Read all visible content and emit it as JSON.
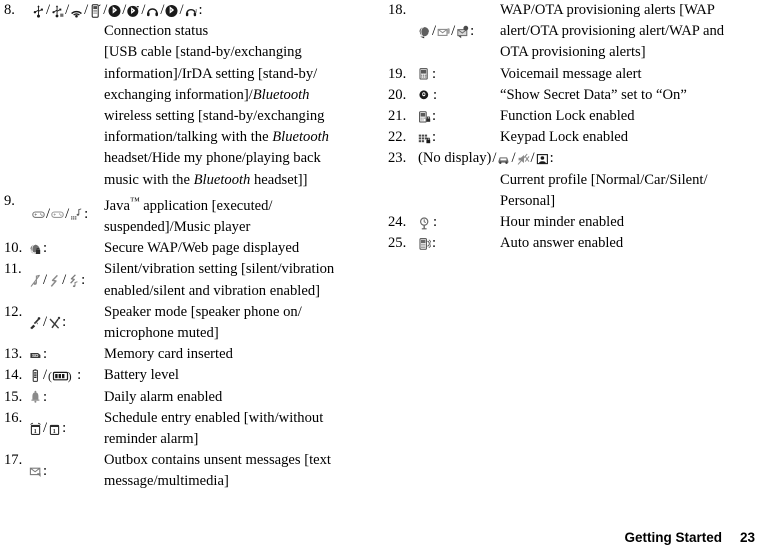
{
  "document": {
    "footer": {
      "section": "Getting Started",
      "page_number": "23"
    }
  },
  "left_column": {
    "entries": [
      {
        "number": "8.",
        "icons": [
          "usb-standby-icon",
          "usb-exchanging-icon",
          "irda-icon",
          "irda-exchanging-icon",
          "bluetooth-standby-icon",
          "bluetooth-exchanging-icon",
          "bluetooth-headset-icon",
          "bluetooth-hide-icon",
          "bluetooth-music-icon"
        ],
        "icon_count": 9,
        "wide": true,
        "lines": [
          "Connection status",
          "[USB cable [stand-by/exchanging",
          "information]/IrDA setting [stand-by/",
          "exchanging information]/BLUETOOTH_ITALIC",
          "wireless setting [stand-by/exchanging",
          "information/talking with the BLUETOOTH_ITALIC",
          "headset/Hide my phone/playing back",
          "music with the BLUETOOTH_ITALIC headset]]"
        ],
        "description": "Connection status [USB cable [stand-by/exchanging information]/IrDA setting [stand-by/exchanging information]/Bluetooth wireless setting [stand-by/exchanging information/talking with the Bluetooth headset/Hide my phone/playing back music with the Bluetooth headset]]"
      },
      {
        "number": "9.",
        "icons": [
          "java-executed-icon",
          "java-suspended-icon",
          "music-player-icon"
        ],
        "icon_count": 3,
        "wide": false,
        "lines": [
          "Java™ application [executed/",
          "suspended]/Music player"
        ],
        "description": "Java™ application [executed/suspended]/Music player"
      },
      {
        "number": "10.",
        "icons": [
          "secure-wap-icon"
        ],
        "icon_count": 1,
        "wide": false,
        "lines": [
          "Secure WAP/Web page displayed"
        ],
        "description": "Secure WAP/Web page displayed"
      },
      {
        "number": "11.",
        "icons": [
          "silent-icon",
          "vibration-icon",
          "silent-vibration-icon"
        ],
        "icon_count": 3,
        "wide": false,
        "lines": [
          "Silent/vibration setting [silent/vibration",
          "enabled/silent and vibration enabled]"
        ],
        "description": "Silent/vibration setting [silent/vibration enabled/silent and vibration enabled]"
      },
      {
        "number": "12.",
        "icons": [
          "speaker-phone-icon",
          "microphone-muted-icon"
        ],
        "icon_count": 2,
        "wide": false,
        "lines": [
          "Speaker mode [speaker phone on/",
          "microphone muted]"
        ],
        "description": "Speaker mode [speaker phone on/microphone muted]"
      },
      {
        "number": "13.",
        "icons": [
          "memory-card-icon"
        ],
        "icon_count": 1,
        "wide": false,
        "lines": [
          "Memory card inserted"
        ],
        "description": "Memory card inserted"
      },
      {
        "number": "14.",
        "icons": [
          "battery-level-icon",
          "battery-charging-icon"
        ],
        "icon_count": 2,
        "wide": false,
        "lines": [
          "Battery level"
        ],
        "description": "Battery level"
      },
      {
        "number": "15.",
        "icons": [
          "daily-alarm-icon"
        ],
        "icon_count": 1,
        "wide": false,
        "lines": [
          "Daily alarm enabled"
        ],
        "description": "Daily alarm enabled"
      },
      {
        "number": "16.",
        "icons": [
          "schedule-with-alarm-icon",
          "schedule-without-alarm-icon"
        ],
        "icon_count": 2,
        "wide": false,
        "lines": [
          "Schedule entry enabled [with/without",
          "reminder alarm]"
        ],
        "description": "Schedule entry enabled [with/without reminder alarm]"
      },
      {
        "number": "17.",
        "icons": [
          "outbox-unsent-icon"
        ],
        "icon_count": 1,
        "wide": false,
        "lines": [
          "Outbox contains unsent messages [text",
          "message/multimedia]"
        ],
        "description": "Outbox contains unsent messages [text message/multimedia]"
      }
    ]
  },
  "right_column": {
    "entries": [
      {
        "number": "18.",
        "icons": [
          "wap-alert-icon",
          "ota-provisioning-alert-icon",
          "wap-ota-alerts-icon"
        ],
        "icon_count": 3,
        "wide": false,
        "lines": [
          "WAP/OTA provisioning alerts [WAP",
          "alert/OTA provisioning alert/WAP and",
          "OTA provisioning alerts]"
        ],
        "description": "WAP/OTA provisioning alerts [WAP alert/OTA provisioning alert/WAP and OTA provisioning alerts]"
      },
      {
        "number": "19.",
        "icons": [
          "voicemail-alert-icon"
        ],
        "icon_count": 1,
        "wide": false,
        "lines": [
          "Voicemail message alert"
        ],
        "description": "Voicemail message alert"
      },
      {
        "number": "20.",
        "icons": [
          "show-secret-data-icon"
        ],
        "icon_count": 1,
        "wide": false,
        "lines": [
          "“Show Secret Data” set to “On”"
        ],
        "description": "“Show Secret Data” set to “On”"
      },
      {
        "number": "21.",
        "icons": [
          "function-lock-icon"
        ],
        "icon_count": 1,
        "wide": false,
        "lines": [
          "Function Lock enabled"
        ],
        "description": "Function Lock enabled"
      },
      {
        "number": "22.",
        "icons": [
          "keypad-lock-icon"
        ],
        "icon_count": 1,
        "wide": false,
        "lines": [
          "Keypad Lock enabled"
        ],
        "description": "Keypad Lock enabled"
      },
      {
        "number": "23.",
        "no_display_label": "(No display)",
        "icons": [
          "car-profile-icon",
          "silent-profile-icon",
          "personal-profile-icon"
        ],
        "icon_count": 3,
        "wide": true,
        "lines": [
          "Current profile [Normal/Car/Silent/",
          "Personal]"
        ],
        "description": "Current profile [Normal/Car/Silent/Personal]"
      },
      {
        "number": "24.",
        "icons": [
          "hour-minder-icon"
        ],
        "icon_count": 1,
        "wide": false,
        "lines": [
          "Hour minder enabled"
        ],
        "description": "Hour minder enabled"
      },
      {
        "number": "25.",
        "icons": [
          "auto-answer-icon"
        ],
        "icon_count": 1,
        "wide": false,
        "lines": [
          "Auto answer enabled"
        ],
        "description": "Auto answer enabled"
      }
    ]
  }
}
